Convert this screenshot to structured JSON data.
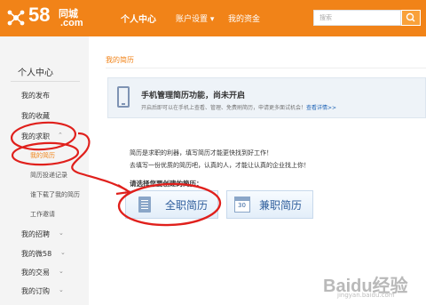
{
  "header": {
    "logo_number": "58",
    "logo_cn": "同城",
    "logo_com": ".com",
    "nav": [
      "个人中心",
      "账户设置",
      "我的资金"
    ],
    "account_caret": "▾",
    "search_placeholder": "搜索"
  },
  "sidebar": {
    "title": "个人中心",
    "items": [
      {
        "label": "我的发布"
      },
      {
        "label": "我的收藏"
      },
      {
        "label": "我的求职"
      },
      {
        "label": "我的简历"
      },
      {
        "label": "简历投递记录"
      },
      {
        "label": "谁下载了我的简历"
      },
      {
        "label": "工作邀请"
      },
      {
        "label": "我的招聘"
      },
      {
        "label": "我的微58"
      },
      {
        "label": "我的交易"
      },
      {
        "label": "我的订购"
      }
    ]
  },
  "main": {
    "breadcrumb": "我的简历",
    "notice_title": "手机管理简历功能，尚未开启",
    "notice_desc": "开启后即可以在手机上查看、管理、免费刷简历，申请更多面试机会！",
    "notice_link": "查看详情>>",
    "intro_line1": "简历是求职的利器，填写简历才能更快找到好工作！",
    "intro_line2": "去填写一份优质的简历吧，认真的人，才能让认真的企业找上你！",
    "choose_label": "请选择您要创建的简历：",
    "fulltime_label": "全职简历",
    "parttime_label": "兼职简历",
    "calendar_day": "30"
  },
  "watermark": {
    "main": "Baidu经验",
    "sub": "jingyan.baidu.com"
  },
  "colors": {
    "brand": "#f18318",
    "annotation": "#e0201c",
    "button_text": "#2f5e9c"
  }
}
